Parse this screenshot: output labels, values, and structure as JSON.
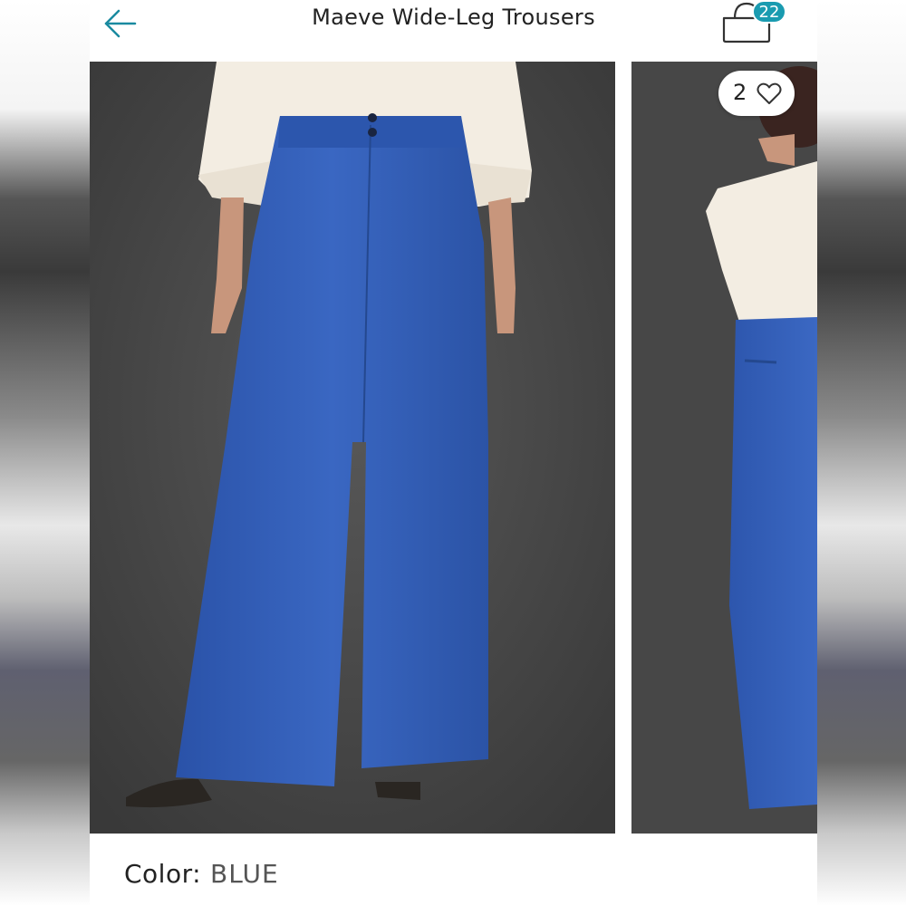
{
  "header": {
    "title": "Maeve Wide-Leg Trousers",
    "cart_count": "22"
  },
  "gallery": {
    "like_count": "2"
  },
  "product": {
    "color_label": "Color:",
    "color_value": "BLUE"
  },
  "colors": {
    "accent": "#1a9bb0",
    "trousers": "#2f5cb5",
    "backdrop": "#474747",
    "shirt": "#f3ede2"
  },
  "icons": {
    "back": "arrow-left-icon",
    "cart": "shopping-bag-icon",
    "like": "heart-outline-icon"
  }
}
